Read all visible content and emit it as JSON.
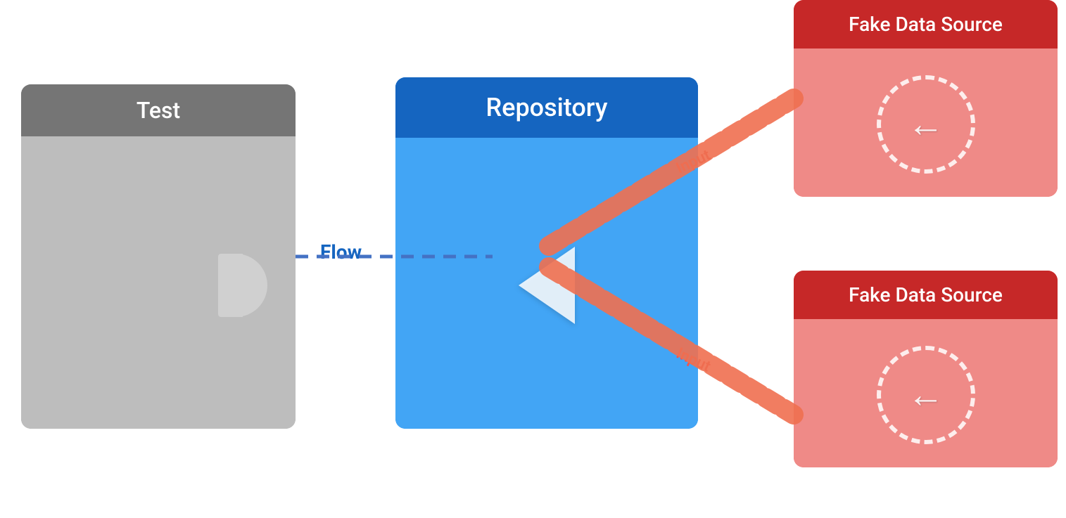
{
  "test_block": {
    "title": "Test"
  },
  "repo_block": {
    "title": "Repository"
  },
  "fake_block_1": {
    "title": "Fake Data Source",
    "input_label": "Input"
  },
  "fake_block_2": {
    "title": "Fake Data Source",
    "input_label": "Input"
  },
  "flow_label": "Flow",
  "colors": {
    "test_header": "#757575",
    "test_body": "#bdbdbd",
    "repo_header": "#1565c0",
    "repo_body": "#42a5f5",
    "fake_header": "#c62828",
    "fake_body": "#ef8a87",
    "flow_connection": "#4472c4",
    "input_connection": "#ef7a5a"
  }
}
